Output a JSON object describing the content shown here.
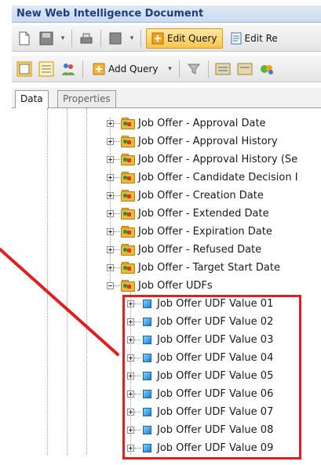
{
  "window": {
    "title": "New Web Intelligence Document"
  },
  "toolbar1": {
    "edit_query_label": "Edit Query",
    "edit_report_label": "Edit Re"
  },
  "toolbar2": {
    "add_query_label": "Add Query"
  },
  "tabs": {
    "data": "Data",
    "properties": "Properties"
  },
  "tree": {
    "folders": [
      "Job Offer - Approval Date",
      "Job Offer - Approval History",
      "Job Offer - Approval History (Se",
      "Job Offer - Candidate Decision I",
      "Job Offer - Creation Date",
      "Job Offer - Extended Date",
      "Job Offer - Expiration Date",
      "Job Offer - Refused Date",
      "Job Offer - Target Start Date"
    ],
    "open_folder": "Job Offer UDFs",
    "children": [
      "Job Offer UDF Value 01",
      "Job Offer UDF Value 02",
      "Job Offer UDF Value 03",
      "Job Offer UDF Value 04",
      "Job Offer UDF Value 05",
      "Job Offer UDF Value 06",
      "Job Offer UDF Value 07",
      "Job Offer UDF Value 08",
      "Job Offer UDF Value 09"
    ]
  },
  "colors": {
    "highlight": "#e02020",
    "folder": "#e8b93c",
    "title": "#1f3f7a"
  }
}
